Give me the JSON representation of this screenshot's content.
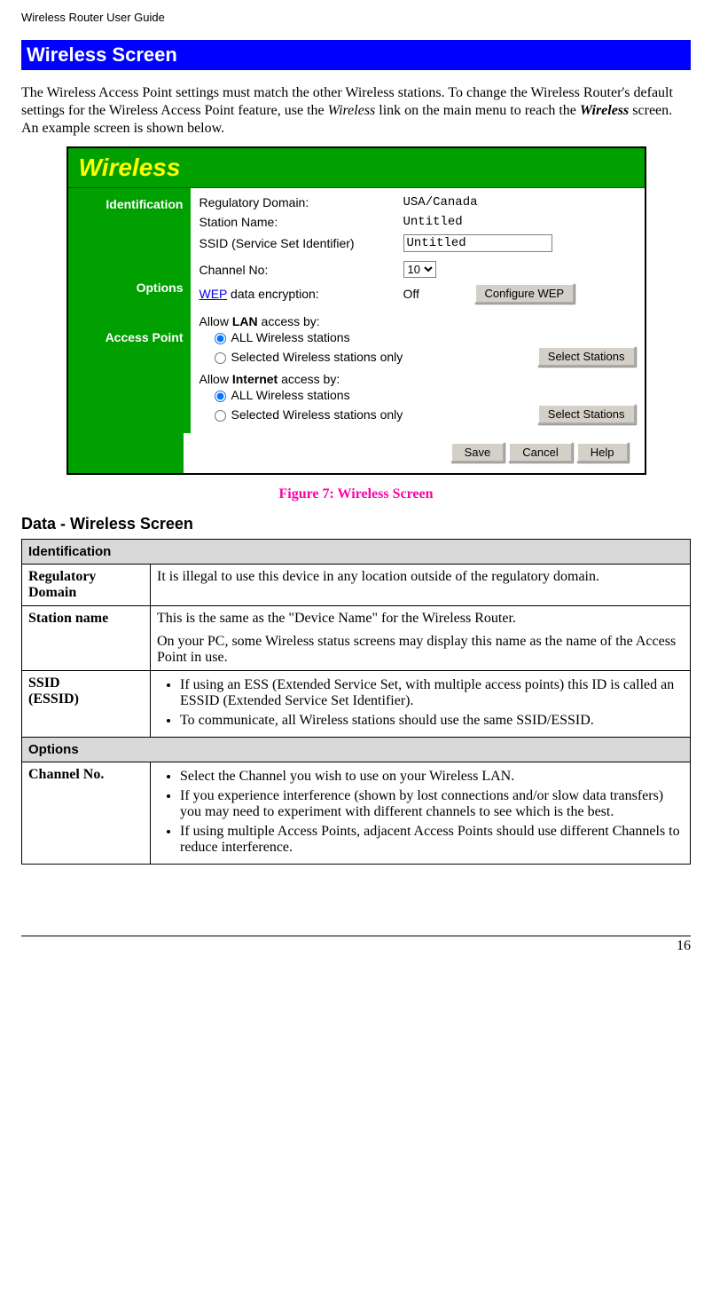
{
  "header": "Wireless Router User Guide",
  "section_title": "Wireless Screen",
  "intro": {
    "p1_a": "The Wireless Access Point settings must match the other Wireless stations. To change the Wireless Router's default settings for the Wireless Access Point feature, use the ",
    "wireless_italic": "Wireless",
    "p1_b": " link on the main menu to reach the ",
    "wireless_bold_italic": "Wireless",
    "p1_c": " screen. An example screen is shown below."
  },
  "figure": {
    "title": "Wireless",
    "side": {
      "identification": "Identification",
      "options": "Options",
      "access_point": "Access Point"
    },
    "identification": {
      "reg_label": "Regulatory Domain:",
      "reg_value": "USA/Canada",
      "station_label": "Station Name:",
      "station_value": "Untitled",
      "ssid_label": "SSID (Service Set Identifier)",
      "ssid_value": "Untitled"
    },
    "options": {
      "channel_label": "Channel No:",
      "channel_value": "10",
      "wep_link": "WEP",
      "wep_rest": " data encryption:",
      "wep_value": "Off",
      "wep_button": "Configure WEP"
    },
    "access_point": {
      "allow_lan_a": "Allow ",
      "allow_lan_b": "LAN",
      "allow_lan_c": " access by:",
      "all1": "ALL Wireless stations",
      "sel1": "Selected Wireless stations only",
      "btn_sel1": "Select Stations",
      "allow_net_a": "Allow ",
      "allow_net_b": "Internet",
      "allow_net_c": " access by:",
      "all2": "ALL Wireless stations",
      "sel2": "Selected Wireless stations only",
      "btn_sel2": "Select Stations"
    },
    "buttons": {
      "save": "Save",
      "cancel": "Cancel",
      "help": "Help"
    },
    "caption": "Figure 7: Wireless Screen"
  },
  "data_section_title": "Data - Wireless Screen",
  "table": {
    "identification_hdr": "Identification",
    "reg_domain_label": "Regulatory Domain",
    "reg_domain_text": "It is illegal to use this device in any location outside of the regulatory domain.",
    "station_label": "Station name",
    "station_text_a": "This is the same as the \"Device Name\" for the Wireless Router.",
    "station_text_b": "On your PC, some Wireless status screens may display this name as the name of the Access Point in use.",
    "ssid_label_a": "SSID",
    "ssid_label_b": "(ESSID)",
    "ssid_b1": "If using an ESS (Extended Service Set, with multiple access points) this ID is called an ESSID (Extended Service Set Identifier).",
    "ssid_b2": "To communicate, all Wireless stations should use the same SSID/ESSID.",
    "options_hdr": "Options",
    "channel_label": "Channel No.",
    "channel_b1": "Select the Channel you wish to use on your Wireless LAN.",
    "channel_b2": "If you experience interference (shown by lost connections and/or slow data transfers) you may need to experiment with different channels to see which is the best.",
    "channel_b3": "If using multiple Access Points, adjacent Access Points should use different Channels to reduce interference."
  },
  "page_number": "16"
}
